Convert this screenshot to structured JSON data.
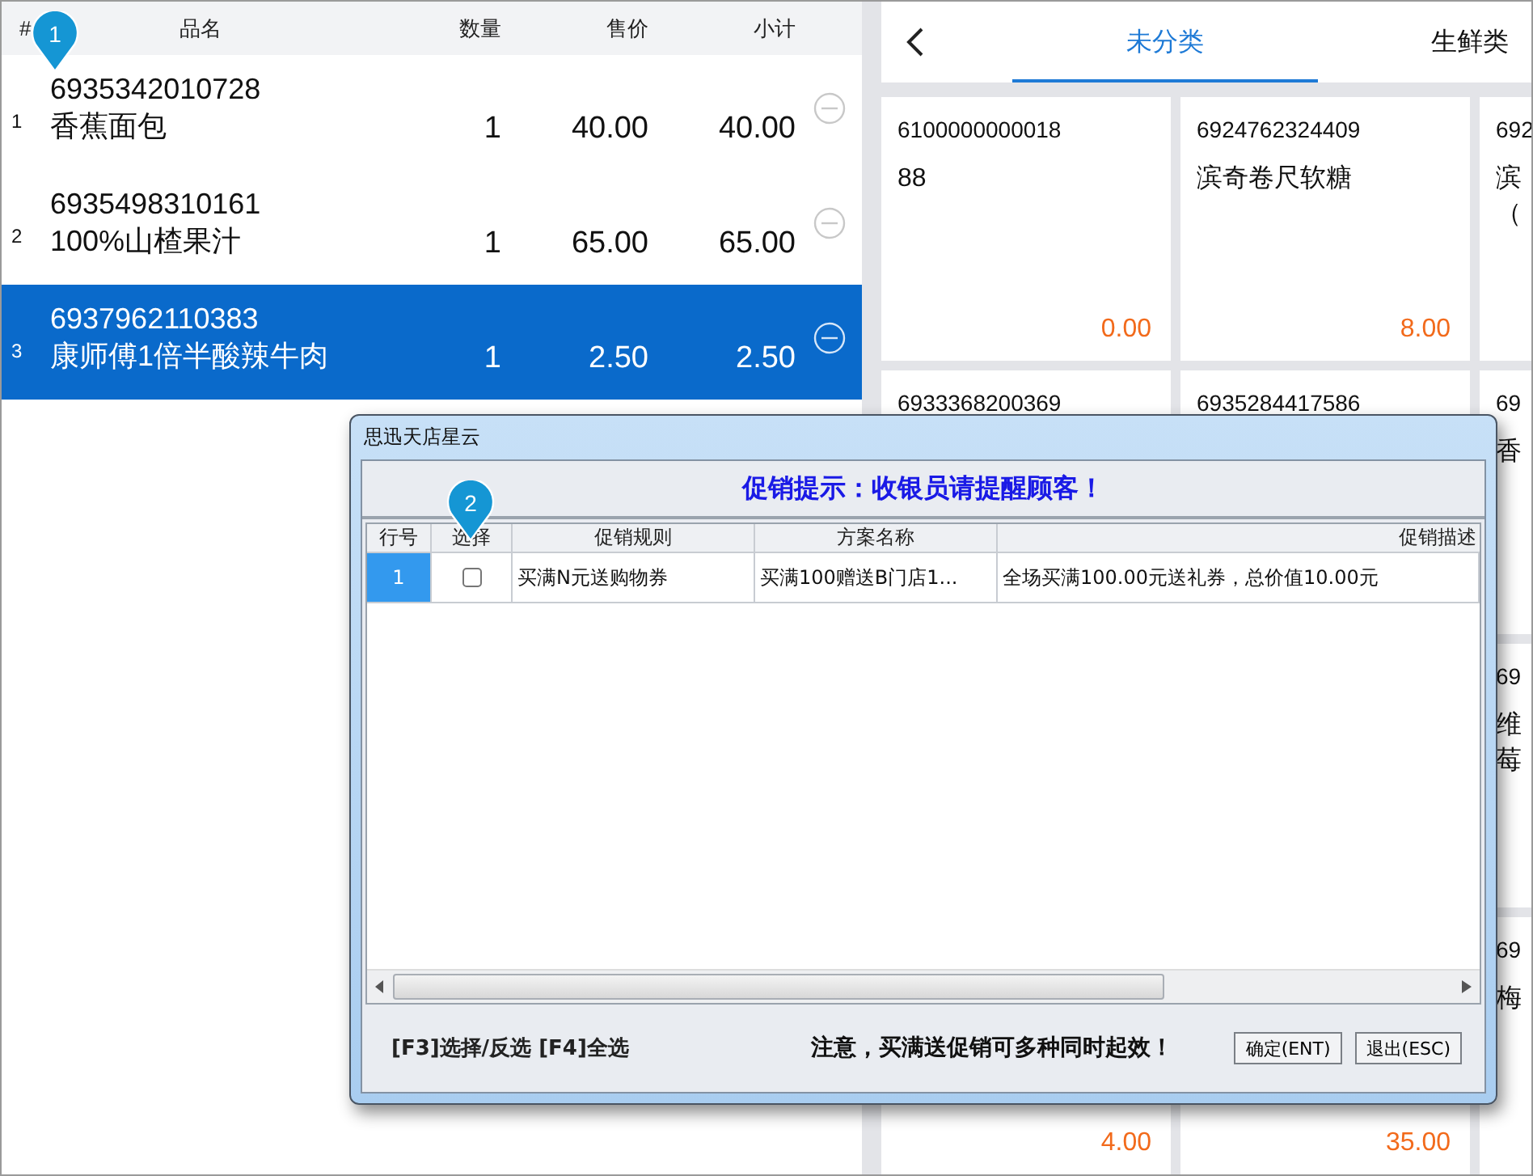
{
  "cart": {
    "columns": [
      "#",
      "品名",
      "数量",
      "售价",
      "小计"
    ],
    "rows": [
      {
        "index": "1",
        "barcode": "6935342010728",
        "name": "香蕉面包",
        "qty": "1",
        "price": "40.00",
        "subtotal": "40.00",
        "selected": false
      },
      {
        "index": "2",
        "barcode": "6935498310161",
        "name": "100%山楂果汁",
        "qty": "1",
        "price": "65.00",
        "subtotal": "65.00",
        "selected": false
      },
      {
        "index": "3",
        "barcode": "6937962110383",
        "name": "康师傅1倍半酸辣牛肉",
        "qty": "1",
        "price": "2.50",
        "subtotal": "2.50",
        "selected": true
      }
    ]
  },
  "catalog": {
    "tabs": [
      {
        "label": "未分类",
        "selected": true
      },
      {
        "label": "生鲜类",
        "selected": false
      }
    ],
    "card_rows": [
      [
        {
          "barcode": "6100000000018",
          "lines": [
            "88"
          ],
          "price": "0.00"
        },
        {
          "barcode": "6924762324409",
          "lines": [
            "滨奇卷尺软糖"
          ],
          "price": "8.00"
        },
        {
          "barcode": "692",
          "lines": [
            "滨",
            "（"
          ]
        }
      ],
      [
        {
          "barcode": "6933368200369"
        },
        {
          "barcode": "6935284417586"
        },
        {
          "barcode": "69",
          "lines": [
            "香"
          ]
        }
      ],
      [
        {
          "barcode": "69",
          "lines": [
            "维",
            "莓"
          ]
        }
      ],
      [
        {
          "price": "4.00"
        },
        {
          "price": "35.00"
        },
        {
          "barcode": "69",
          "lines": [
            "梅"
          ]
        }
      ]
    ]
  },
  "dialog": {
    "title": "思迅天店星云",
    "heading": "促销提示：收银员请提醒顾客！",
    "table": {
      "columns": [
        "行号",
        "选择",
        "促销规则",
        "方案名称",
        "促销描述"
      ],
      "rows": [
        {
          "row_no": "1",
          "selected": true,
          "checked": false,
          "rule": "买满N元送购物券",
          "plan": "买满100赠送B门店1...",
          "description": "全场买满100.00元送礼券，总价值10.00元"
        }
      ]
    },
    "hint": "[F3]选择/反选 [F4]全选",
    "notice": "注意，买满送促销可多种同时起效！",
    "buttons": [
      "确定(ENT)",
      "退出(ESC)"
    ]
  },
  "markers": [
    {
      "label": "1"
    },
    {
      "label": "2"
    }
  ]
}
